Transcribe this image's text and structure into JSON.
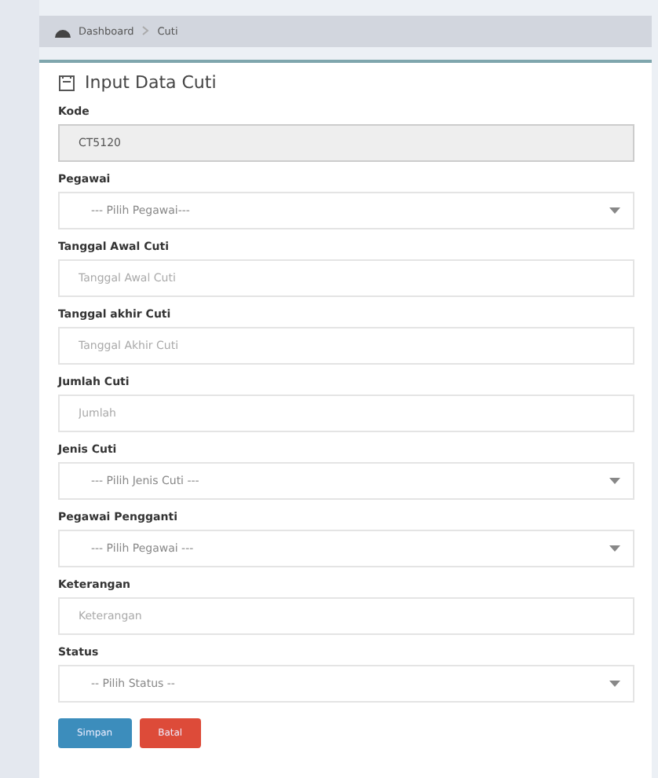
{
  "breadcrumb": [
    {
      "label": "Dashboard",
      "kind": "home"
    },
    {
      "label": "Cuti",
      "kind": "page"
    }
  ],
  "form": {
    "title": "Input Data Cuti",
    "fields": [
      {
        "label": "Kode",
        "kind": "readonly",
        "value": "CT5120"
      },
      {
        "label": "Pegawai",
        "kind": "select",
        "value": "--- Pilih Pegawai---"
      },
      {
        "label": "Tanggal Awal Cuti",
        "kind": "input",
        "placeholder": "Tanggal Awal Cuti"
      },
      {
        "label": "Tanggal akhir Cuti",
        "kind": "input",
        "placeholder": "Tanggal Akhir Cuti"
      },
      {
        "label": "Jumlah Cuti",
        "kind": "input",
        "placeholder": "Jumlah"
      },
      {
        "label": "Jenis Cuti",
        "kind": "select",
        "value": "--- Pilih Jenis Cuti ---"
      },
      {
        "label": "Pegawai Pengganti",
        "kind": "select",
        "value": "--- Pilih Pegawai ---"
      },
      {
        "label": "Keterangan",
        "kind": "input",
        "placeholder": "Keterangan"
      },
      {
        "label": "Status",
        "kind": "select",
        "value": "-- Pilih Status --"
      }
    ],
    "buttons": [
      {
        "label": "Simpan",
        "kind": "primary"
      },
      {
        "label": "Batal",
        "kind": "danger"
      }
    ]
  }
}
